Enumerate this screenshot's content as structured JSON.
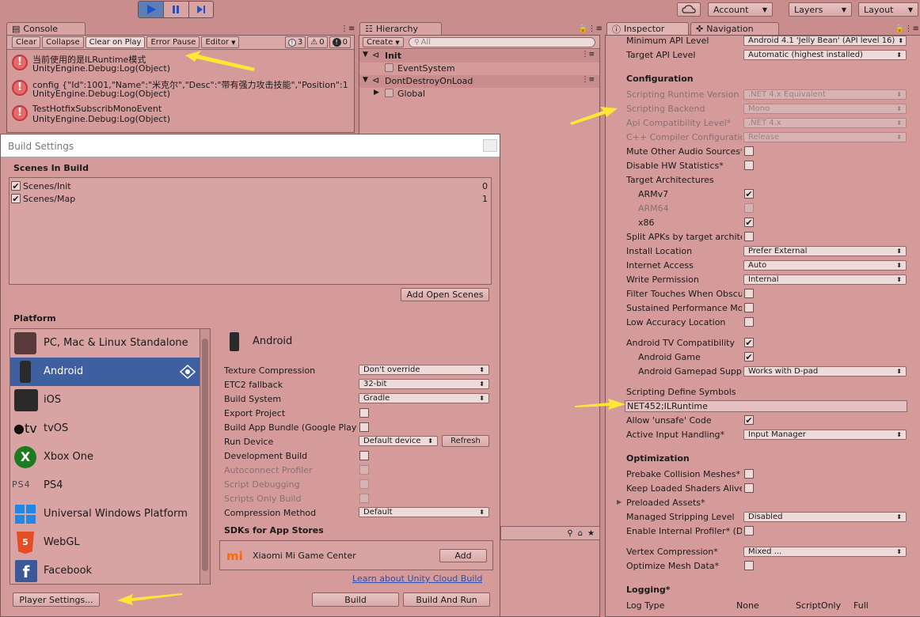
{
  "toolbar": {
    "play_icon": "play-icon",
    "pause_icon": "pause-icon",
    "step_icon": "step-icon",
    "cloud_icon": "cloud-icon",
    "account": "Account",
    "layers": "Layers",
    "layout": "Layout"
  },
  "console": {
    "tab": "Console",
    "clear": "Clear",
    "collapse": "Collapse",
    "clear_on_play": "Clear on Play",
    "error_pause": "Error Pause",
    "editor": "Editor",
    "count_info": "3",
    "count_warn": "0",
    "count_error": "0",
    "entries": [
      {
        "line1": "当前使用的是ILRuntime模式",
        "line2": "UnityEngine.Debug:Log(Object)"
      },
      {
        "line1": "config {\"Id\":1001,\"Name\":\"米克尔\",\"Desc\":\"带有强力攻击技能\",\"Position\":1",
        "line2": "UnityEngine.Debug:Log(Object)"
      },
      {
        "line1": "TestHotfixSubscribMonoEvent",
        "line2": "UnityEngine.Debug:Log(Object)"
      }
    ]
  },
  "hierarchy": {
    "tab": "Hierarchy",
    "create": "Create",
    "search_placeholder": "All",
    "items": [
      {
        "label": "Init"
      },
      {
        "label": "EventSystem"
      },
      {
        "label": "DontDestroyOnLoad"
      },
      {
        "label": "Global"
      }
    ]
  },
  "build": {
    "title": "Build Settings",
    "scenes_header": "Scenes In Build",
    "scenes": [
      {
        "name": "Scenes/Init",
        "index": "0"
      },
      {
        "name": "Scenes/Map",
        "index": "1"
      }
    ],
    "add_open_scenes": "Add Open Scenes",
    "platform_header": "Platform",
    "platforms": [
      {
        "label": "PC, Mac & Linux Standalone",
        "icon": "pc-icon"
      },
      {
        "label": "Android",
        "icon": "android-icon"
      },
      {
        "label": "iOS",
        "icon": "ios-icon"
      },
      {
        "label": "tvOS",
        "icon": "tvos-icon"
      },
      {
        "label": "Xbox One",
        "icon": "xbox-icon"
      },
      {
        "label": "PS4",
        "icon": "ps4-icon"
      },
      {
        "label": "Universal Windows Platform",
        "icon": "windows-icon"
      },
      {
        "label": "WebGL",
        "icon": "webgl-icon"
      },
      {
        "label": "Facebook",
        "icon": "facebook-icon"
      }
    ],
    "selected_platform": "Android",
    "settings": {
      "texture_compression": {
        "label": "Texture Compression",
        "value": "Don't override"
      },
      "etc2": {
        "label": "ETC2 fallback",
        "value": "32-bit"
      },
      "build_system": {
        "label": "Build System",
        "value": "Gradle"
      },
      "export_project": "Export Project",
      "app_bundle": "Build App Bundle (Google Play)",
      "run_device": {
        "label": "Run Device",
        "value": "Default device",
        "refresh": "Refresh"
      },
      "development_build": "Development Build",
      "autoconnect": "Autoconnect Profiler",
      "script_debugging": "Script Debugging",
      "scripts_only": "Scripts Only Build",
      "compression": {
        "label": "Compression Method",
        "value": "Default"
      }
    },
    "sdk_header": "SDKs for App Stores",
    "sdk_item": "Xiaomi Mi Game Center",
    "sdk_add": "Add",
    "cloud_link": "Learn about Unity Cloud Build",
    "player_settings": "Player Settings...",
    "build_btn": "Build",
    "build_and_run": "Build And Run"
  },
  "inspector": {
    "tab": "Inspector",
    "nav_tab": "Navigation",
    "min_api": {
      "label": "Minimum API Level",
      "value": "Android 4.1 'Jelly Bean' (API level 16)"
    },
    "target_api": {
      "label": "Target API Level",
      "value": "Automatic (highest installed)"
    },
    "configuration": "Configuration",
    "runtime_version": {
      "label": "Scripting Runtime Version",
      "value": ".NET 4.x Equivalent"
    },
    "backend": {
      "label": "Scripting Backend",
      "value": "Mono"
    },
    "api_compat": {
      "label": "Api Compatibility Level*",
      "value": ".NET 4.x"
    },
    "cpp_compiler": {
      "label": "C++ Compiler Configuration",
      "value": "Release"
    },
    "mute_audio": "Mute Other Audio Sources*",
    "disable_hw": "Disable HW Statistics*",
    "target_arch": "Target Architectures",
    "armv7": "ARMv7",
    "arm64": "ARM64",
    "x86": "x86",
    "split_apks": "Split APKs by target architecture",
    "install_location": {
      "label": "Install Location",
      "value": "Prefer External"
    },
    "internet_access": {
      "label": "Internet Access",
      "value": "Auto"
    },
    "write_permission": {
      "label": "Write Permission",
      "value": "Internal"
    },
    "filter_touches": "Filter Touches When Obscured",
    "sustained_perf": "Sustained Performance Mode",
    "low_accuracy": "Low Accuracy Location",
    "android_tv": "Android TV Compatibility",
    "android_game": "Android Game",
    "gamepad": {
      "label": "Android Gamepad Support Level",
      "value": "Works with D-pad"
    },
    "define_symbols_label": "Scripting Define Symbols",
    "define_symbols_value": "NET452;ILRuntime",
    "allow_unsafe": "Allow 'unsafe' Code",
    "input_handling": {
      "label": "Active Input Handling*",
      "value": "Input Manager"
    },
    "optimization": "Optimization",
    "prebake": "Prebake Collision Meshes*",
    "keep_shaders": "Keep Loaded Shaders Alive*",
    "preloaded": "Preloaded Assets*",
    "stripping": {
      "label": "Managed Stripping Level",
      "value": "Disabled"
    },
    "internal_profiler": "Enable Internal Profiler* (Deprecated)",
    "vertex_compression": {
      "label": "Vertex Compression*",
      "value": "Mixed ..."
    },
    "optimize_mesh": "Optimize Mesh Data*",
    "logging": "Logging*",
    "log_type": "Log Type",
    "none": "None",
    "script_only": "ScriptOnly",
    "full": "Full"
  },
  "colors": {
    "highlight": "#3e5fa0",
    "arrow": "#ffe733",
    "panel": "#d59b9b"
  }
}
